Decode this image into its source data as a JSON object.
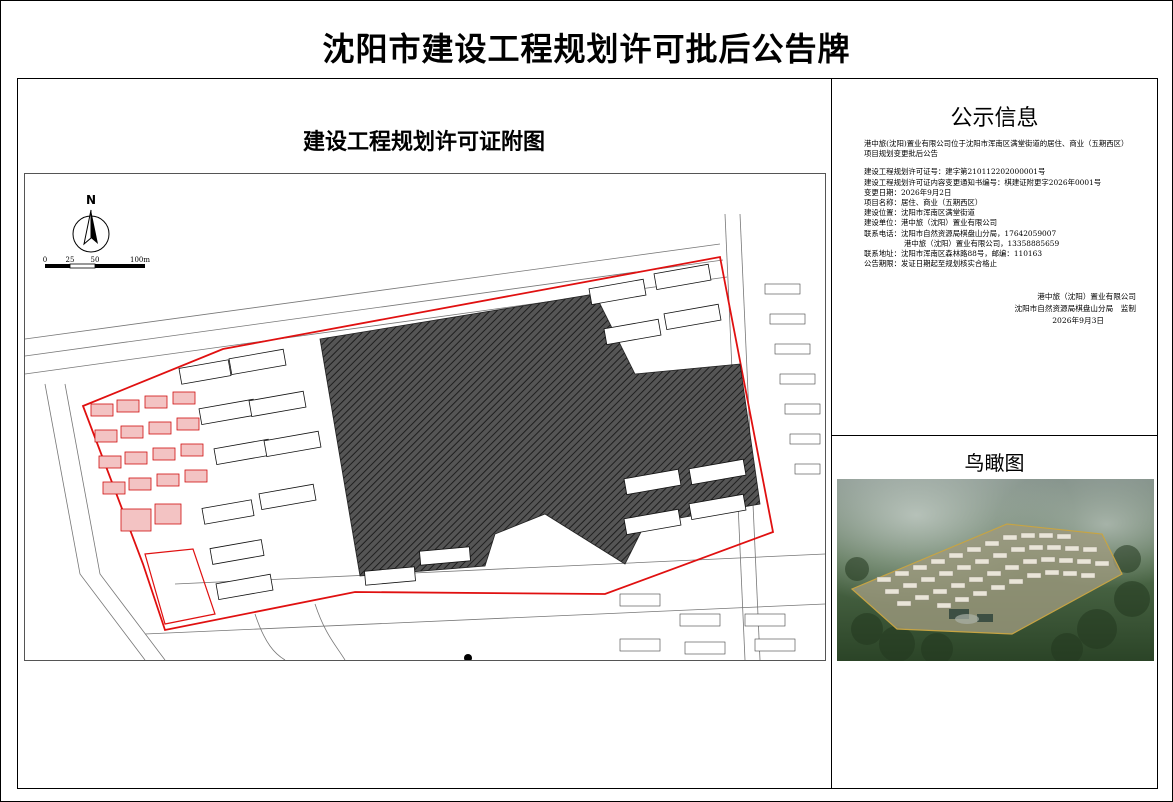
{
  "page_title": "沈阳市建设工程规划许可批后公告牌",
  "map": {
    "title": "建设工程规划许可证附图",
    "north_label": "N",
    "scale_labels": [
      "0",
      "25",
      "50",
      "100m"
    ]
  },
  "info": {
    "title": "公示信息",
    "intro": "港中旅(沈阳)置业有限公司位于沈阳市浑南区满堂街道的居住、商业（五期西区）项目规划变更批后公告",
    "lines": [
      "建设工程规划许可证号：建字第210112202000001号",
      "建设工程规划许可证内容变更通知书编号：棋建证附更字2026年0001号",
      "变更日期：2026年9月2日",
      "项目名称：居住、商业（五期西区）",
      "建设位置：沈阳市浑南区满堂街道",
      "建设单位：港中旅（沈阳）置业有限公司",
      "联系电话：沈阳市自然资源局棋盘山分局，17642059007"
    ],
    "phone_line2": "港中旅（沈阳）置业有限公司，13358885659",
    "lines_after": [
      "联系地址：沈阳市浑南区森林路88号，邮编：110163",
      "公告期限：发证日期起至规划核实合格止"
    ],
    "signature": [
      "港中旅（沈阳）置业有限公司",
      "沈阳市自然资源局棋盘山分局　监制",
      "2026年9月3日"
    ]
  },
  "aerial": {
    "title": "鸟瞰图"
  },
  "colors": {
    "boundary": "#e01010",
    "hatch": "#3a3a3a",
    "line": "#000000"
  }
}
